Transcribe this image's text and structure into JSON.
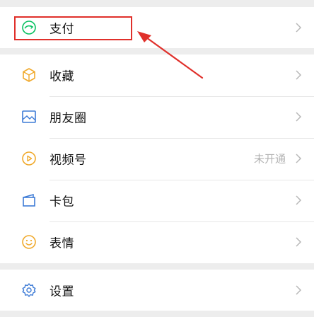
{
  "menu": {
    "pay": {
      "label": "支付"
    },
    "favorites": {
      "label": "收藏"
    },
    "moments": {
      "label": "朋友圈"
    },
    "channels": {
      "label": "视频号",
      "status": "未开通"
    },
    "cards": {
      "label": "卡包"
    },
    "stickers": {
      "label": "表情"
    },
    "settings": {
      "label": "设置"
    }
  },
  "colors": {
    "accent_green": "#07c160",
    "highlight_red": "#e0302b",
    "background": "#ededed",
    "row_background": "#ffffff",
    "secondary_text": "#b3b3b3"
  },
  "icons": [
    "pay-icon",
    "favorites-icon",
    "moments-icon",
    "channels-icon",
    "cards-icon",
    "stickers-icon",
    "settings-icon",
    "chevron-right-icon"
  ]
}
